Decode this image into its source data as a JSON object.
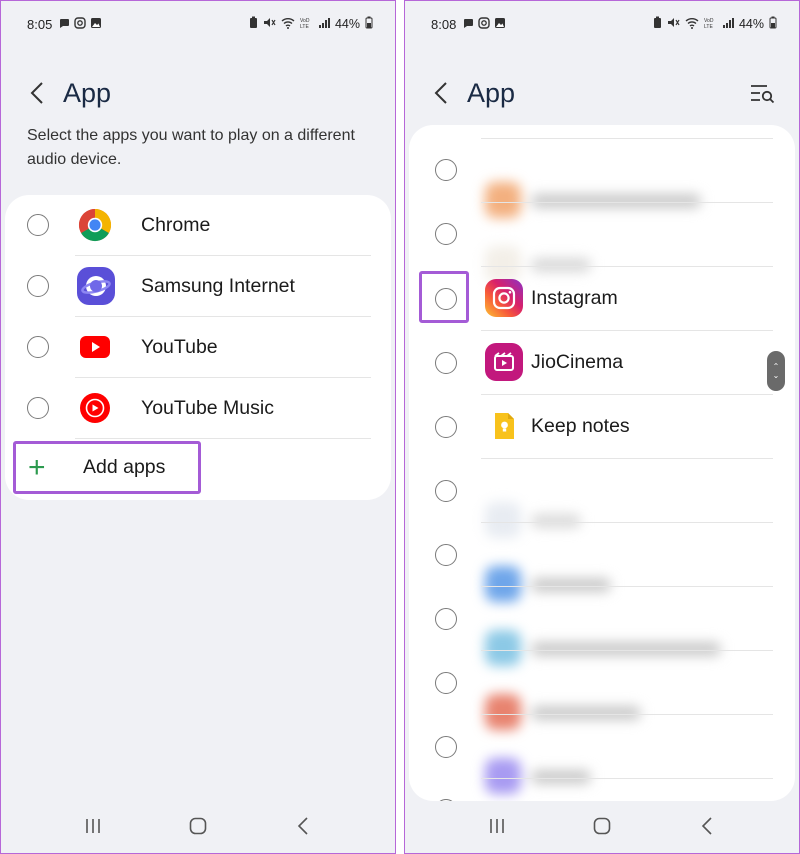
{
  "left": {
    "status": {
      "time": "8:05",
      "battery": "44%"
    },
    "header": {
      "title": "App"
    },
    "description": "Select the apps you want to play on a different audio device.",
    "apps": [
      {
        "label": "Chrome",
        "icon": "chrome-icon"
      },
      {
        "label": "Samsung Internet",
        "icon": "samsung-internet-icon"
      },
      {
        "label": "YouTube",
        "icon": "youtube-icon"
      },
      {
        "label": "YouTube Music",
        "icon": "youtube-music-icon"
      }
    ],
    "add_apps_label": "Add apps"
  },
  "right": {
    "status": {
      "time": "8:08",
      "battery": "44%"
    },
    "header": {
      "title": "App"
    },
    "apps": [
      {
        "label": "Instagram",
        "icon": "instagram-icon"
      },
      {
        "label": "JioCinema",
        "icon": "jiocinema-icon"
      },
      {
        "label": "Keep notes",
        "icon": "keep-notes-icon"
      }
    ]
  },
  "colors": {
    "highlight": "#a45bd6",
    "add_plus": "#2c9a4e",
    "background": "#f0f1f5"
  }
}
